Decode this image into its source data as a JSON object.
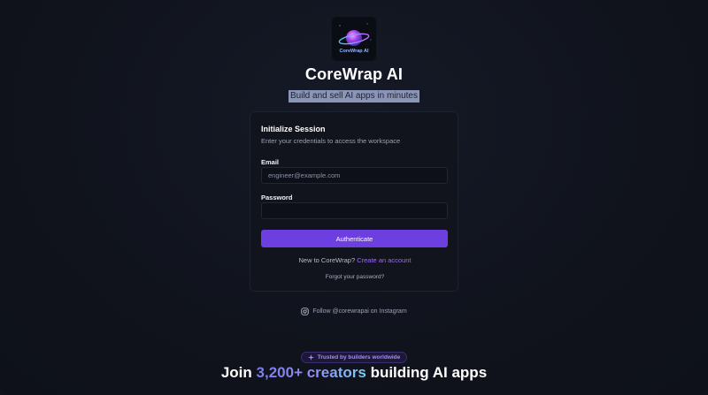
{
  "brand": {
    "logo_text": "CoreWrap AI",
    "title": "CoreWrap AI",
    "tagline": "Build and sell AI apps in minutes"
  },
  "card": {
    "title": "Initialize Session",
    "subtitle": "Enter your credentials to access the workspace",
    "email_label": "Email",
    "email_placeholder": "engineer@example.com",
    "email_value": "",
    "password_label": "Password",
    "password_value": "",
    "submit_label": "Authenticate",
    "signup_prompt": "New to CoreWrap?",
    "signup_link": "Create an account",
    "forgot_link": "Forgot your password?"
  },
  "social": {
    "instagram_icon": "instagram-icon",
    "instagram_text": "Follow @corewrapai on Instagram"
  },
  "footer": {
    "badge_icon": "sparkle-icon",
    "badge_text": "Trusted by builders worldwide",
    "join_prefix": "Join",
    "join_highlight": "3,200+ creators",
    "join_suffix": "building AI apps"
  },
  "colors": {
    "background": "#10131c",
    "accent": "#6d3fe0",
    "link": "#9b6cf7"
  }
}
